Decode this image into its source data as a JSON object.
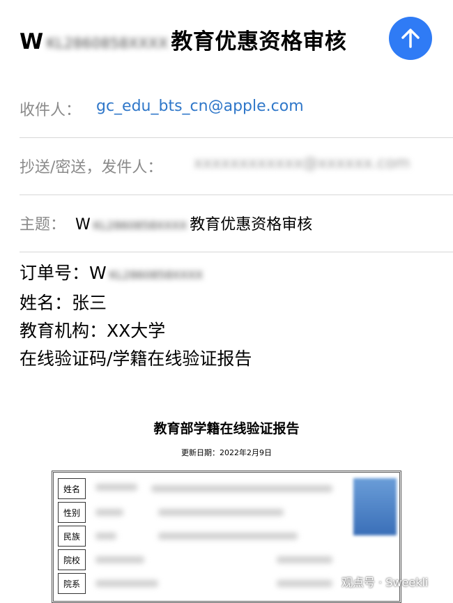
{
  "header": {
    "title_prefix": "W",
    "title_blurred": "KL2860858XXXX",
    "title_suffix": "教育优惠资格审核",
    "send_icon": "arrow-up-icon",
    "send_color": "#2f7bf5"
  },
  "to": {
    "label": "收件人：",
    "value": "gc_edu_bts_cn@apple.com"
  },
  "cc": {
    "label": "抄送/密送，发件人：",
    "value_blurred": "xxxxxxxxxxxx@xxxxxx.com"
  },
  "subject": {
    "label": "主题：",
    "prefix": "W",
    "blurred": "KL2860858XXXX",
    "suffix": "教育优惠资格审核"
  },
  "body": {
    "order_label": "订单号：",
    "order_prefix": "W",
    "order_blurred": "KL2860858XXXX",
    "name": "姓名：张三",
    "institution": "教育机构：XX大学",
    "report_line": "在线验证码/学籍在线验证报告"
  },
  "report": {
    "title": "教育部学籍在线验证报告",
    "date": "更新日期：2022年2月9日",
    "fields": [
      "姓名",
      "性别",
      "民族",
      "院校",
      "院系"
    ]
  },
  "watermark": "观点号 · Sweekli"
}
